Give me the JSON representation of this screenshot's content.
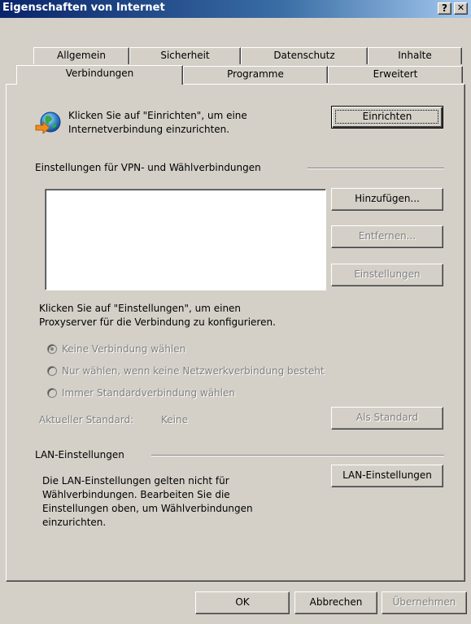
{
  "window": {
    "title": "Eigenschaften von Internet",
    "help_btn": "?",
    "close_btn": "✕"
  },
  "tabs_row1": [
    "Allgemein",
    "Sicherheit",
    "Datenschutz",
    "Inhalte"
  ],
  "tabs_row2": [
    "Verbindungen",
    "Programme",
    "Erweitert"
  ],
  "active_tab": "Verbindungen",
  "setup": {
    "text_line1": "Klicken Sie auf \"Einrichten\", um eine",
    "text_line2": "Internetverbindung einzurichten.",
    "button_label": "Einrichten",
    "icon": "globe-network-icon"
  },
  "vpn": {
    "group_label": "Einstellungen für VPN- und Wählverbindungen",
    "connections": [],
    "add_button": "Hinzufügen...",
    "remove_button": "Entfernen...",
    "settings_button": "Einstellungen",
    "proxy_line1": "Klicken Sie auf \"Einstellungen\", um einen",
    "proxy_line2": "Proxyserver für die Verbindung zu konfigurieren.",
    "radio_options": [
      {
        "label": "Keine Verbindung wählen",
        "selected": true
      },
      {
        "label": "Nur wählen, wenn keine Netzwerkverbindung besteht",
        "selected": false
      },
      {
        "label": "Immer Standardverbindung wählen",
        "selected": false
      }
    ],
    "current_default_label": "Aktueller Standard:",
    "current_default_value": "Keine",
    "set_default_button": "Als Standard"
  },
  "lan": {
    "group_label": "LAN-Einstellungen",
    "text_lines": [
      "Die LAN-Einstellungen gelten nicht für",
      "Wählverbindungen. Bearbeiten Sie die",
      "Einstellungen oben, um Wählverbindungen",
      "einzurichten."
    ],
    "button_label": "LAN-Einstellungen"
  },
  "footer": {
    "ok": "OK",
    "cancel": "Abbrechen",
    "apply": "Übernehmen"
  }
}
